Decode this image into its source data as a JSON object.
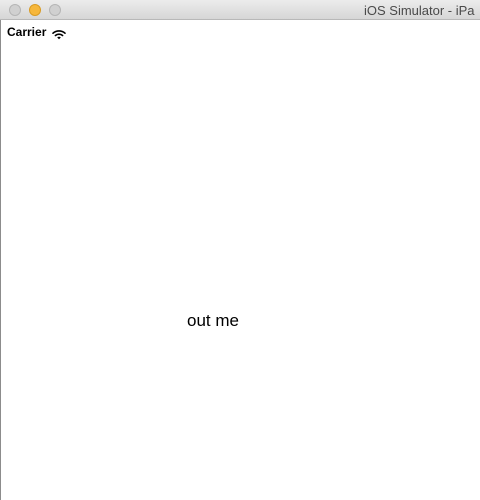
{
  "window": {
    "title": "iOS Simulator - iPa"
  },
  "status_bar": {
    "carrier": "Carrier",
    "signal_icon": "wifi-icon"
  },
  "content": {
    "label": "out me"
  },
  "colors": {
    "minimize_button": "#f6b73c",
    "inactive_button": "#d0d0d0",
    "titlebar": "#dcdcdc"
  }
}
